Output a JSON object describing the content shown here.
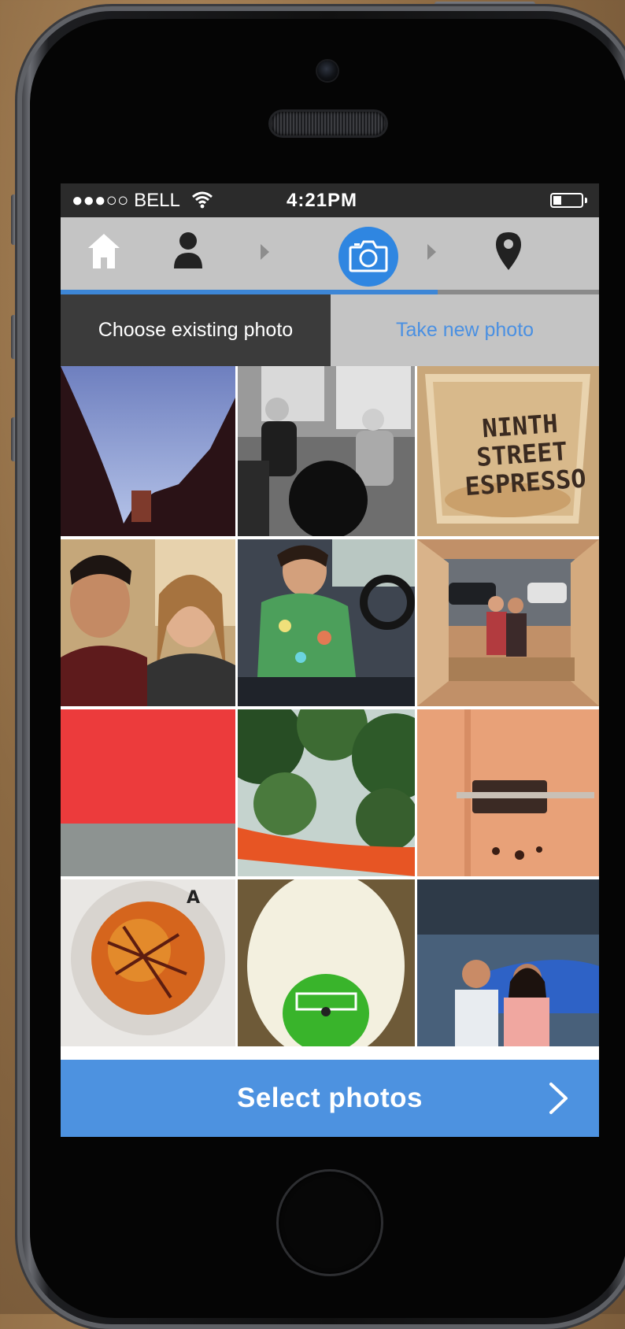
{
  "status_bar": {
    "carrier": "●●●○○ BELL",
    "time": "4:21PM",
    "wifi_icon": "wifi-icon",
    "battery_level": 0.3
  },
  "nav": {
    "steps": [
      {
        "icon": "home-icon",
        "active": false
      },
      {
        "icon": "person-icon",
        "active": false
      },
      {
        "icon": "camera-icon",
        "active": true
      },
      {
        "icon": "location-pin-icon",
        "active": false
      }
    ],
    "progress_fraction": 0.7
  },
  "tabs": {
    "choose_existing": "Choose existing photo",
    "take_new": "Take new photo",
    "active": "choose_existing"
  },
  "photos": {
    "espresso_cup_text": "NINTH\nSTREET\nESPRESSO",
    "selected_index": 2
  },
  "footer": {
    "select_photos_label": "Select photos"
  },
  "colors": {
    "accent": "#3d86d6",
    "nav_background": "#c4c4c4",
    "tab_active_background": "#3b3b3b",
    "inactive_tab_text": "#4a90e2"
  }
}
